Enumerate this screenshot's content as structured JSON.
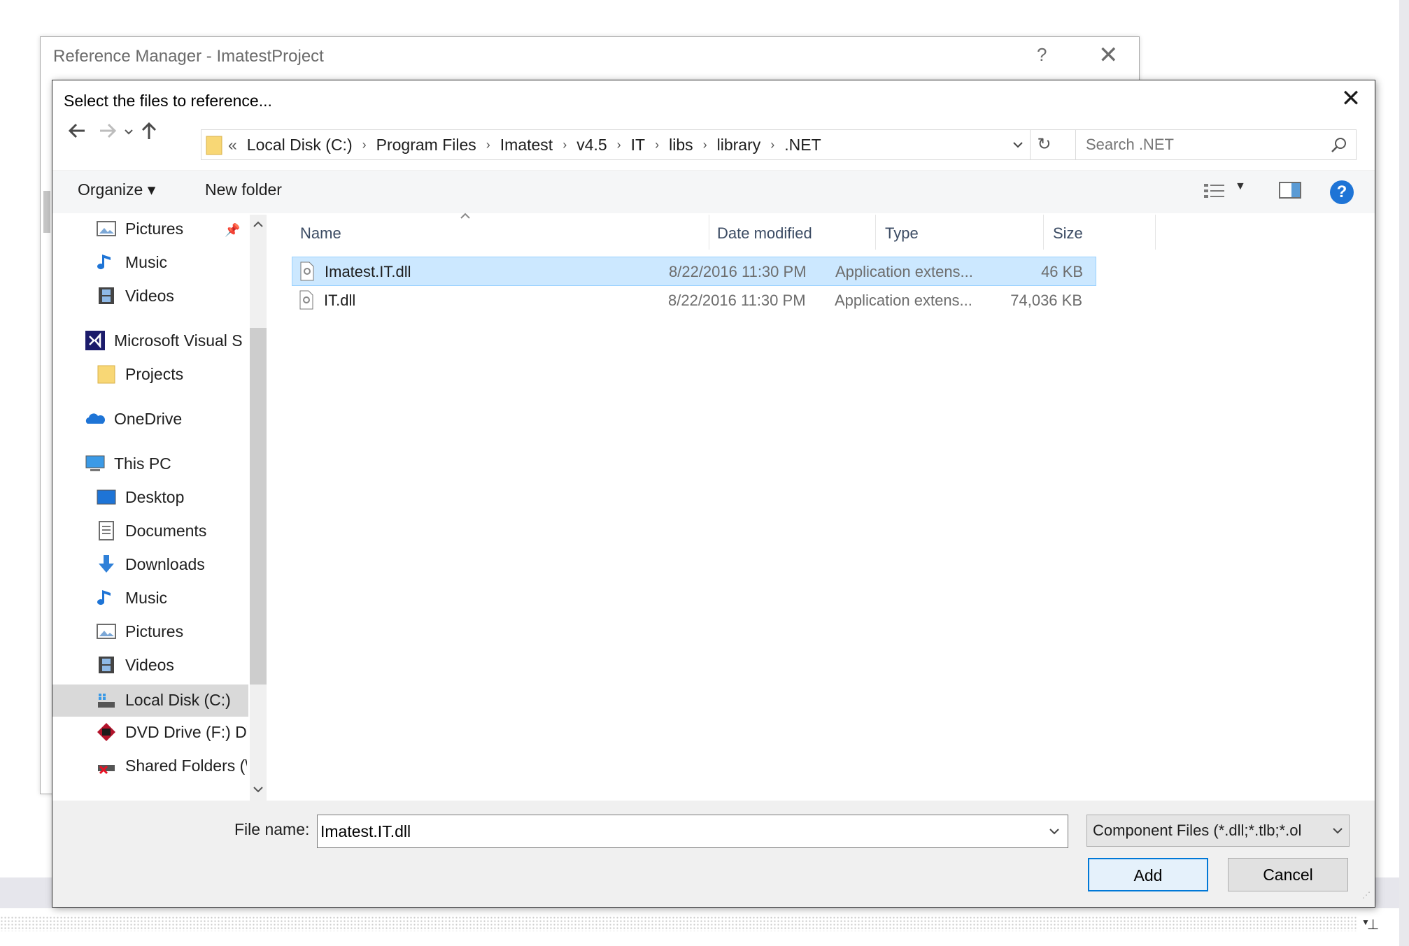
{
  "background": {
    "window_title": "Reference Manager - ImatestProject",
    "help_glyph": "?",
    "close_glyph": "✕"
  },
  "dialog": {
    "title": "Select the files to reference...",
    "close_glyph": "✕",
    "address": {
      "overflow": "«",
      "crumbs": [
        "Local Disk (C:)",
        "Program Files",
        "Imatest",
        "v4.5",
        "IT",
        "libs",
        "library",
        ".NET"
      ]
    },
    "search": {
      "placeholder": "Search .NET"
    },
    "toolbar": {
      "organize": "Organize ▾",
      "new_folder": "New folder",
      "help": "?"
    },
    "nav_pane": {
      "items": [
        {
          "label": "Pictures",
          "icon": "pictures-icon"
        },
        {
          "label": "Music",
          "icon": "music-icon"
        },
        {
          "label": "Videos",
          "icon": "videos-icon"
        },
        {
          "label": "Microsoft Visual S",
          "icon": "visual-studio-icon"
        },
        {
          "label": "Projects",
          "icon": "folder-icon"
        },
        {
          "label": "OneDrive",
          "icon": "onedrive-icon"
        },
        {
          "label": "This PC",
          "icon": "computer-icon"
        },
        {
          "label": "Desktop",
          "icon": "desktop-icon"
        },
        {
          "label": "Documents",
          "icon": "documents-icon"
        },
        {
          "label": "Downloads",
          "icon": "downloads-icon"
        },
        {
          "label": "Music",
          "icon": "music-icon"
        },
        {
          "label": "Pictures",
          "icon": "pictures-icon"
        },
        {
          "label": "Videos",
          "icon": "videos-icon"
        },
        {
          "label": "Local Disk (C:)",
          "icon": "drive-icon"
        },
        {
          "label": "DVD Drive (F:) D\\",
          "icon": "dvd-icon"
        },
        {
          "label": "Shared Folders (\\",
          "icon": "network-drive-icon"
        }
      ]
    },
    "file_list": {
      "columns": [
        "Name",
        "Date modified",
        "Type",
        "Size"
      ],
      "rows": [
        {
          "name": "Imatest.IT.dll",
          "date": "8/22/2016 11:30 PM",
          "type": "Application extens...",
          "size": "46 KB",
          "selected": true
        },
        {
          "name": "IT.dll",
          "date": "8/22/2016 11:30 PM",
          "type": "Application extens...",
          "size": "74,036 KB",
          "selected": false
        }
      ]
    },
    "bottom": {
      "file_name_label": "File name:",
      "file_name_value": "Imatest.IT.dll",
      "filter": "Component Files (*.dll;*.tlb;*.ol",
      "add": "Add",
      "cancel": "Cancel"
    }
  },
  "colors": {
    "accent": "#0078d7",
    "selection": "#cce8ff",
    "help_blue": "#1e74d6"
  }
}
